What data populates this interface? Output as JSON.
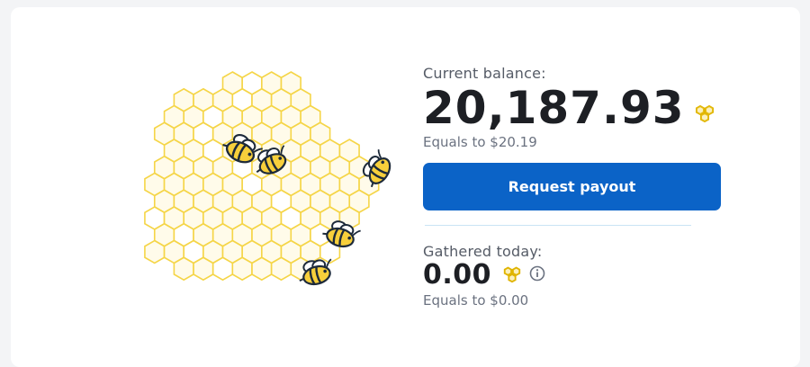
{
  "balance": {
    "label": "Current balance:",
    "amount": "20,187.93",
    "equals": "Equals to $20.19",
    "icon": "honeycomb-coin-icon"
  },
  "actions": {
    "payout_label": "Request payout"
  },
  "today": {
    "label": "Gathered today:",
    "amount": "0.00",
    "equals": "Equals to $0.00",
    "info_icon": "info-icon"
  },
  "colors": {
    "accent": "#0b63c7",
    "honey_stroke": "#f5d547",
    "honey_fill": "#fffbea",
    "bee_body": "#f7cf3b",
    "bee_outline": "#1d2a3a"
  },
  "illustration": {
    "name": "beehive-illustration",
    "bees": 5
  }
}
